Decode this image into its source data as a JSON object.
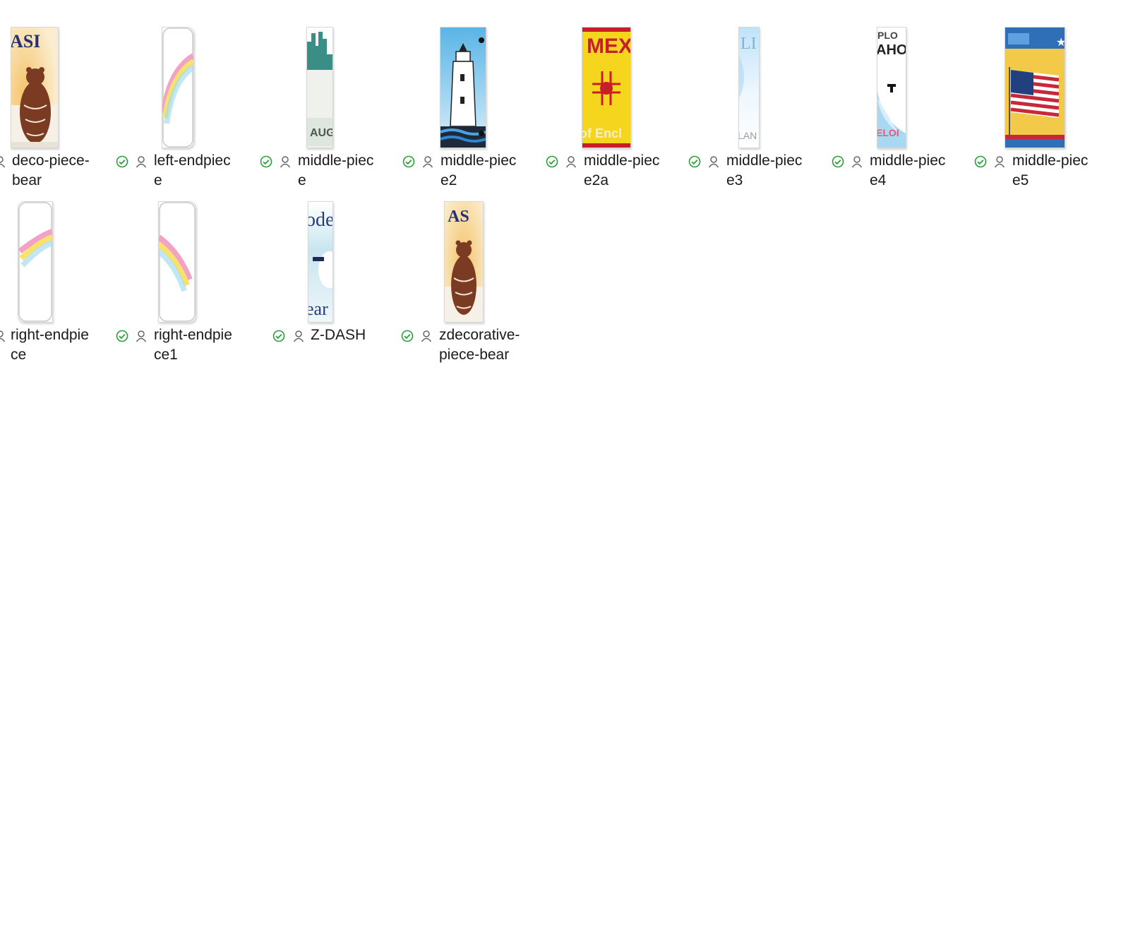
{
  "colors": {
    "status_synced": "#2a9d3a",
    "person_icon": "#666666",
    "text": "#1a1a1a"
  },
  "icons": {
    "status": "synced-check-icon",
    "owner": "person-icon"
  },
  "files": [
    {
      "name": "deco-piece-bear",
      "display": "deco-piece-\nbear",
      "status": "available-offline",
      "thumbnail": "grizzly-bear"
    },
    {
      "name": "left-endpiece",
      "display": "left-endpiec\ne",
      "status": "available-offline",
      "thumbnail": "rainbow-arc"
    },
    {
      "name": "middle-piece",
      "display": "middle-piec\ne",
      "status": "available-offline",
      "thumbnail": "skyline"
    },
    {
      "name": "middle-piece2",
      "display": "middle-piec\ne2",
      "status": "available-offline",
      "thumbnail": "lighthouse"
    },
    {
      "name": "middle-piece2a",
      "display": "middle-piec\ne2a",
      "status": "available-offline",
      "thumbnail": "zia-sun"
    },
    {
      "name": "middle-piece3",
      "display": "middle-piec\ne3",
      "status": "available-offline",
      "thumbnail": "pale-sky"
    },
    {
      "name": "middle-piece4",
      "display": "middle-piec\ne4",
      "status": "available-offline",
      "thumbnail": "mountain-plate"
    },
    {
      "name": "middle-piece5",
      "display": "middle-piec\ne5",
      "status": "available-offline",
      "thumbnail": "us-flag"
    },
    {
      "name": "right-endpiece",
      "display": "right-endpie\nce",
      "status": "available-offline",
      "thumbnail": "rainbow-arc"
    },
    {
      "name": "right-endpiece1",
      "display": "right-endpie\nce1",
      "status": "available-offline",
      "thumbnail": "rainbow-arc"
    },
    {
      "name": "Z-DASH",
      "display": "Z-DASH",
      "status": "available-offline",
      "thumbnail": "dash-plate"
    },
    {
      "name": "zdecorative-piece-bear",
      "display": "zdecorative-\npiece-bear",
      "status": "available-offline",
      "thumbnail": "grizzly-bear"
    }
  ],
  "thumb_text": {
    "bear_top": "ASI",
    "bear2_top": "AS",
    "skyline_bottom": "AUG",
    "zia_top": "MEX",
    "zia_bottom": "of Encl",
    "pale_top": "LI",
    "pale_bottom": "LAN",
    "mountain_top": "PLO",
    "mountain_mid": "AHO",
    "mountain_bottom": "ELOI",
    "dash_top": "ode",
    "dash_bottom": "ear"
  }
}
